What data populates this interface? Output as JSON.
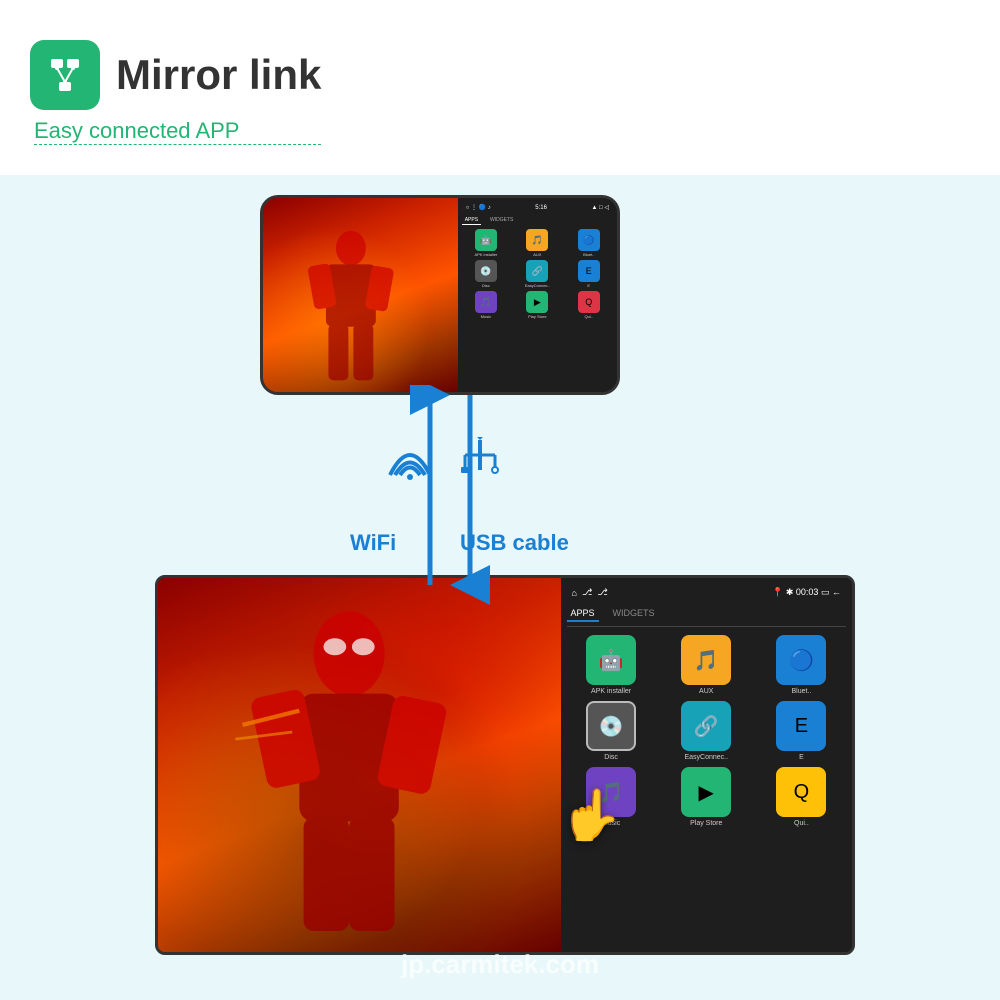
{
  "header": {
    "icon_label": "mirror-link-icon",
    "title": "Mirror link",
    "subtitle": "Easy connected APP"
  },
  "diagram": {
    "phone": {
      "status_time": "5:16",
      "tabs": [
        "APPS",
        "WIDGETS"
      ],
      "apps": [
        {
          "label": "APK installer",
          "icon": "🤖",
          "color": "icon-green"
        },
        {
          "label": "AUX",
          "icon": "🎵",
          "color": "icon-orange"
        },
        {
          "label": "Bluet..",
          "icon": "🔵",
          "color": "icon-blue"
        },
        {
          "label": "Disc",
          "icon": "💿",
          "color": "icon-gray"
        },
        {
          "label": "EasyConnec..",
          "icon": "🔗",
          "color": "icon-teal"
        },
        {
          "label": "E",
          "icon": "E",
          "color": "icon-blue"
        },
        {
          "label": "Music",
          "icon": "🎵",
          "color": "icon-purple"
        },
        {
          "label": "Play Store",
          "icon": "▶",
          "color": "icon-green"
        },
        {
          "label": "Qui..",
          "icon": "Q",
          "color": "icon-red"
        }
      ]
    },
    "connection": {
      "wifi_label": "WiFi",
      "usb_label": "USB cable"
    },
    "car_unit": {
      "status_time": "00:03",
      "tabs": [
        "APPS",
        "WIDGETS"
      ],
      "apps": [
        {
          "label": "APK installer",
          "icon": "🤖",
          "color": "icon-green"
        },
        {
          "label": "AUX",
          "icon": "🎵",
          "color": "icon-orange"
        },
        {
          "label": "Bluet..",
          "icon": "🔵",
          "color": "icon-blue"
        },
        {
          "label": "Disc",
          "icon": "💿",
          "color": "icon-gray"
        },
        {
          "label": "EasyConnec..",
          "icon": "🔗",
          "color": "icon-teal"
        },
        {
          "label": "E",
          "icon": "E",
          "color": "icon-blue"
        },
        {
          "label": "Music",
          "icon": "🎵",
          "color": "icon-purple"
        },
        {
          "label": "Play Store",
          "icon": "▶",
          "color": "icon-green"
        },
        {
          "label": "Qui..",
          "icon": "Q",
          "color": "icon-red"
        }
      ]
    }
  },
  "watermark": "jp.carmitek.com"
}
